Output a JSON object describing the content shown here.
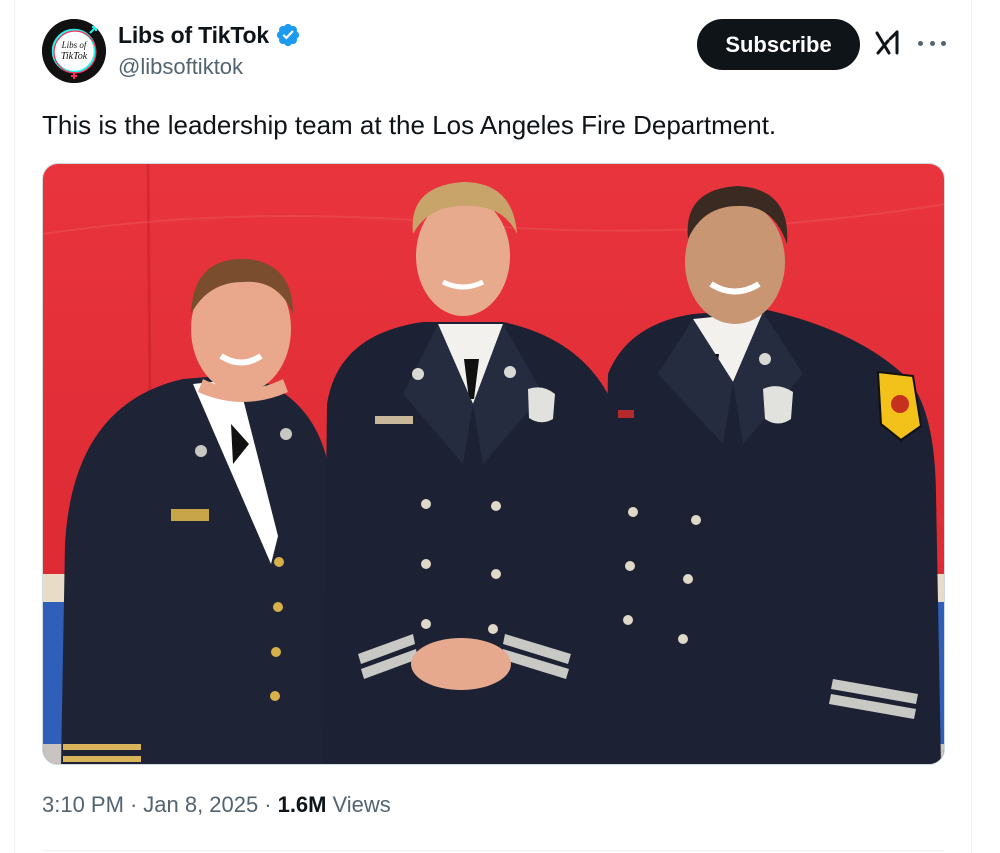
{
  "account": {
    "display_name": "Libs of TikTok",
    "handle": "@libsoftiktok",
    "verified": true,
    "avatar_icon": "libs-of-tiktok-logo",
    "avatar_text_line1": "Libs of",
    "avatar_text_line2": "TikTok"
  },
  "header": {
    "subscribe_label": "Subscribe",
    "grok_icon": "grok-icon",
    "more_icon": "more-icon"
  },
  "tweet": {
    "text": "This is the leadership team at the Los Angeles Fire Department.",
    "media_icon": "photo-three-uniformed-officers"
  },
  "meta": {
    "time": "3:10 PM",
    "date": "Jan 8, 2025",
    "separator": "·",
    "views_count": "1.6M",
    "views_label": "Views"
  },
  "colors": {
    "text": "#0f1419",
    "secondary": "#536471",
    "verified": "#1d9bf0",
    "subscribe_bg": "#0f1419",
    "backdrop_red": "#e8333b",
    "uniform_navy": "#1c2233"
  }
}
